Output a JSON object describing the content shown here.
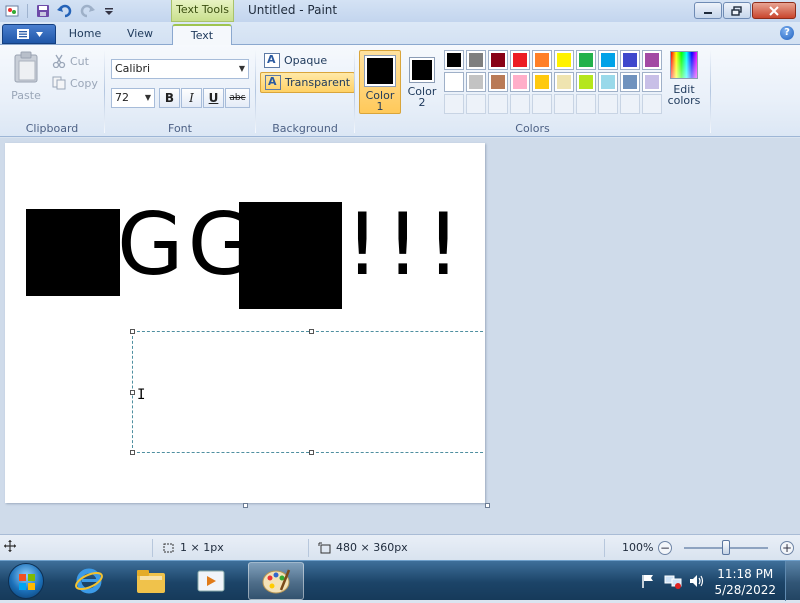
{
  "window": {
    "title": "Untitled - Paint",
    "context_tab_group": "Text Tools"
  },
  "tabs": [
    {
      "label": "Home"
    },
    {
      "label": "View"
    },
    {
      "label": "Text"
    }
  ],
  "clipboard": {
    "paste": "Paste",
    "cut": "Cut",
    "copy": "Copy",
    "group_label": "Clipboard"
  },
  "font": {
    "family": "Calibri",
    "size": "72",
    "bold": "B",
    "italic": "I",
    "underline": "U",
    "strike": "abc",
    "group_label": "Font"
  },
  "background": {
    "opaque": "Opaque",
    "transparent": "Transparent",
    "group_label": "Background"
  },
  "colors": {
    "color1_label": "Color 1",
    "color1_line1": "Color",
    "color1_line2": "1",
    "color2_line1": "Color",
    "color2_line2": "2",
    "color1_value": "#000000",
    "color2_value": "#000000",
    "edit_line1": "Edit",
    "edit_line2": "colors",
    "group_label": "Colors",
    "palette_row1": [
      "#000000",
      "#7f7f7f",
      "#880015",
      "#ed1c24",
      "#ff7f27",
      "#fff200",
      "#22b14c",
      "#00a2e8",
      "#3f48cc",
      "#a349a4"
    ],
    "palette_row2": [
      "#ffffff",
      "#c3c3c3",
      "#b97a57",
      "#ffaec9",
      "#ffc90e",
      "#efe4b0",
      "#b5e61d",
      "#99d9ea",
      "#7092be",
      "#c8bfe7"
    ]
  },
  "canvas": {
    "text_visible_1": "GG",
    "text_visible_2": "!!!"
  },
  "status": {
    "selection_size": "1 × 1px",
    "canvas_size": "480 × 360px",
    "zoom": "100%",
    "zoom_minus": "−",
    "zoom_plus": "+"
  },
  "taskbar": {
    "time": "11:18 PM",
    "date": "5/28/2022"
  },
  "help": "?"
}
